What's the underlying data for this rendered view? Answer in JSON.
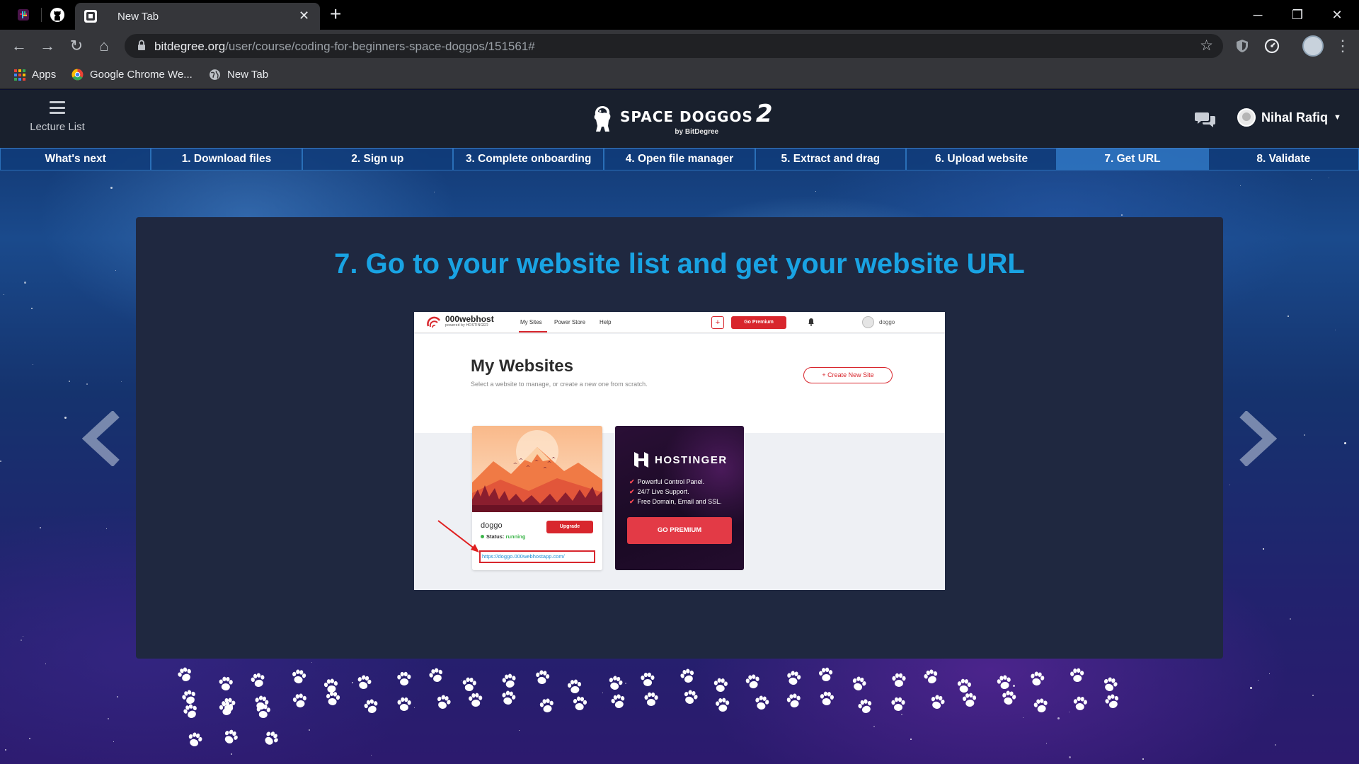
{
  "browser": {
    "active_tab_title": "New Tab",
    "url_host": "bitdegree.org",
    "url_path": "/user/course/coding-for-beginners-space-doggos/151561#",
    "bookmarks": [
      {
        "label": "Apps",
        "icon": "apps-grid-icon"
      },
      {
        "label": "Google Chrome We...",
        "icon": "chrome-icon"
      },
      {
        "label": "New Tab",
        "icon": "globe-icon"
      }
    ]
  },
  "site": {
    "lecture_list_label": "Lecture List",
    "brand_title": "SPACE DOGGOS",
    "brand_number": "2",
    "brand_sub": "by BitDegree",
    "user_name": "Nihal Rafiq",
    "steps": [
      "What's next",
      "1. Download files",
      "2. Sign up",
      "3. Complete onboarding",
      "4. Open file manager",
      "5. Extract and drag",
      "6. Upload website",
      "7. Get URL",
      "8. Validate"
    ],
    "active_step_index": 7,
    "content_title": "7. Go to your website list and get your website URL"
  },
  "screenshot": {
    "logo": "000webhost",
    "logo_sub": "powered by HOSTINGER",
    "nav_links": [
      "My Sites",
      "Power Store",
      "Help"
    ],
    "plus_label": "+",
    "premium_label": "Go Premium",
    "user": "doggo",
    "heading": "My Websites",
    "subheading": "Select a website to manage, or create a new one from scratch.",
    "create_label": "+ Create New Site",
    "site_name": "doggo",
    "status_label": "Status:",
    "status_value": "running",
    "upgrade_label": "Upgrade",
    "site_url": "https://doggo.000webhostapp.com/",
    "promo_brand": "HOSTINGER",
    "promo_features": [
      "Powerful Control Panel.",
      "24/7 Live Support.",
      "Free Domain, Email and SSL."
    ],
    "promo_button": "GO PREMIUM"
  },
  "colors": {
    "accent_title": "#19a3e3",
    "step_active": "#3078c4",
    "red": "#d8262d"
  }
}
